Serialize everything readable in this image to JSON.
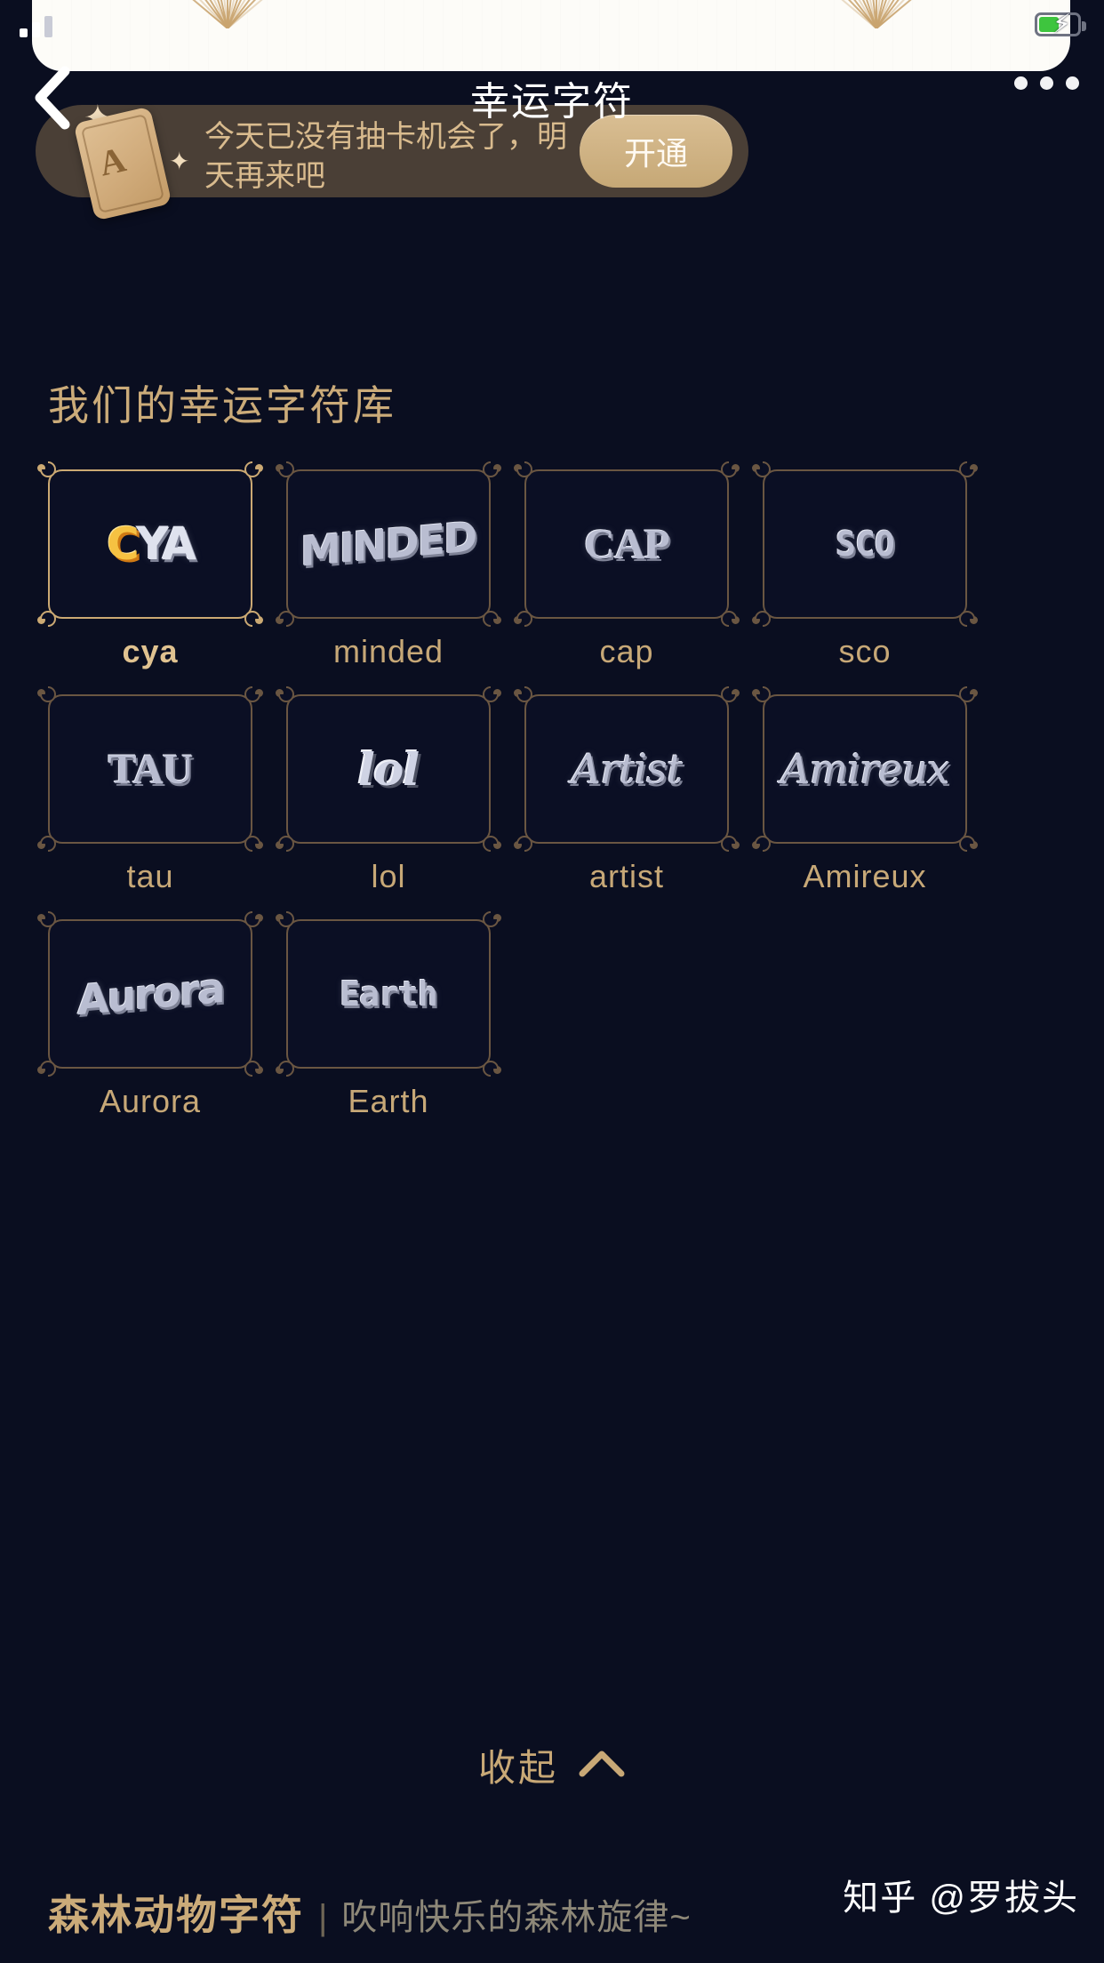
{
  "statusbar": {
    "signal_icon": "signal-bars-icon",
    "battery_icon": "battery-charging-icon"
  },
  "nav": {
    "back_icon": "back-chevron-icon",
    "title": "幸运字符",
    "more_icon": "more-dots-icon"
  },
  "banner": {
    "card_icon": "draw-card-icon",
    "card_glyph": "A",
    "sparkle_icon": "sparkle-icon",
    "message": "今天已没有抽卡机会了，明天再来吧",
    "button_label": "开通",
    "bg_color": "#4a3f36",
    "button_color": "#cfb184",
    "text_color": "#d9bb8e"
  },
  "library": {
    "section_title": "我们的幸运字符库",
    "accent_color": "#cbab79",
    "border_color": "#6a5642",
    "selected_border_color": "#cba973",
    "cards": [
      {
        "label": "cya",
        "art": "CYA",
        "style": "cya",
        "selected": true
      },
      {
        "label": "minded",
        "art": "MINDED",
        "style": "chunky",
        "selected": false
      },
      {
        "label": "cap",
        "art": "CAP",
        "style": "serif",
        "selected": false
      },
      {
        "label": "sco",
        "art": "SCO",
        "style": "slab",
        "selected": false
      },
      {
        "label": "tau",
        "art": "TAU",
        "style": "serif",
        "selected": false
      },
      {
        "label": "lol",
        "art": "lol",
        "style": "bubble",
        "selected": false
      },
      {
        "label": "artist",
        "art": "Artist",
        "style": "script",
        "selected": false
      },
      {
        "label": "Amireux",
        "art": "Amireux",
        "style": "script",
        "selected": false
      },
      {
        "label": "Aurora",
        "art": "Aurora",
        "style": "chunky",
        "selected": false
      },
      {
        "label": "Earth",
        "art": "Earth",
        "style": "slab",
        "selected": false
      }
    ]
  },
  "collapse": {
    "label": "收起",
    "icon": "chevron-up-icon"
  },
  "next_section": {
    "title": "森林动物字符",
    "divider": "|",
    "subtitle": "吹响快乐的森林旋律~"
  },
  "watermark": {
    "text": "知乎 @罗拔头"
  }
}
